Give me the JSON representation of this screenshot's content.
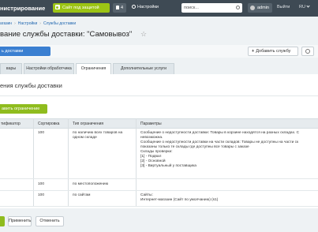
{
  "topbar": {
    "brand": "нистрирование",
    "site_button": "Сайт под защитой",
    "notifications_count": "4",
    "settings": "Настройки",
    "search_placeholder": "поиск...",
    "user": "admin",
    "exit": "Выйти",
    "language": "RU"
  },
  "breadcrumb": [
    "агазин",
    "Настройки",
    "Службы доставки"
  ],
  "page_title": "вание службы доставки: \"Самовывоз\"",
  "toolbar": {
    "list_button": "ь доставки",
    "add_service_button": "Добавить службу"
  },
  "tabs": [
    {
      "label": "вары",
      "active": false
    },
    {
      "label": "Настройки обработчика",
      "active": false
    },
    {
      "label": "Ограничения",
      "active": true
    },
    {
      "label": "Дополнительные услуги",
      "active": false
    }
  ],
  "section_title": "ения службы доставки",
  "add_restriction_button": "авить ограничение",
  "table": {
    "headers": [
      "тификатор",
      "Сортировка",
      "Тип ограничения",
      "Параметры"
    ],
    "rows": [
      {
        "sort": "100",
        "type": "по наличию всех товаров на одном складе",
        "params": [
          "Сообщение о недоступности доставки: Товары в корзине находятся на разных складах. С",
          "невозможна.",
          "Сообщение о недоступности доставки на части складов: Товары не доступны на части ск",
          "показаны только те склады где доступны все товары с заказе",
          "Склады проверки:",
          "[1] - Подвал",
          "[2] - Основной",
          "[3] - Виртуальный у поставщика"
        ]
      },
      {
        "sort": "100",
        "type": "по местоположению",
        "params": []
      },
      {
        "sort": "100",
        "type": "по сайтам",
        "params": [
          "Сайты:",
          "Интернет-магазин (Сайт по умолчанию) (s1)"
        ]
      }
    ]
  },
  "footer": {
    "apply_button": "Применить",
    "cancel_button": "Отменить"
  }
}
